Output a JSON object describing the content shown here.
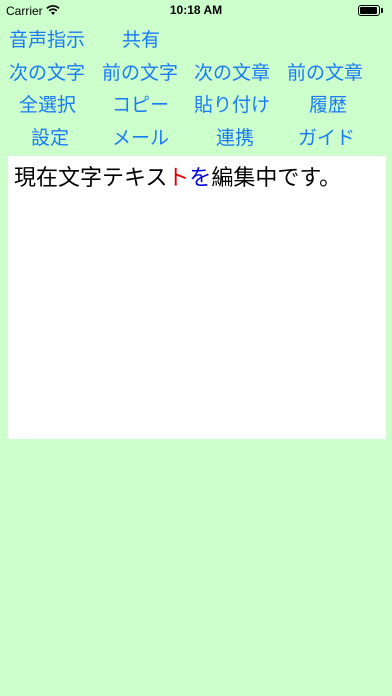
{
  "status_bar": {
    "carrier": "Carrier",
    "time": "10:18 AM",
    "wifi_icon": "wifi-icon",
    "battery_icon": "battery-icon"
  },
  "menu": {
    "row1": [
      "音声指示",
      "共有"
    ],
    "row2": [
      "次の文字",
      "前の文字",
      "次の文章",
      "前の文章"
    ],
    "row3": [
      "全選択",
      "コピー",
      "貼り付け",
      "履歴"
    ],
    "row4": [
      "設定",
      "メール",
      "連携",
      "ガイド"
    ]
  },
  "editor": {
    "text_before": "現在文字テキス",
    "text_red": "ト",
    "text_blue": "を",
    "text_after": "編集中です。"
  },
  "colors": {
    "background": "#ccffcc",
    "button_text": "#1a7cf5",
    "highlight_red": "#e00000",
    "highlight_blue": "#0000e0"
  }
}
